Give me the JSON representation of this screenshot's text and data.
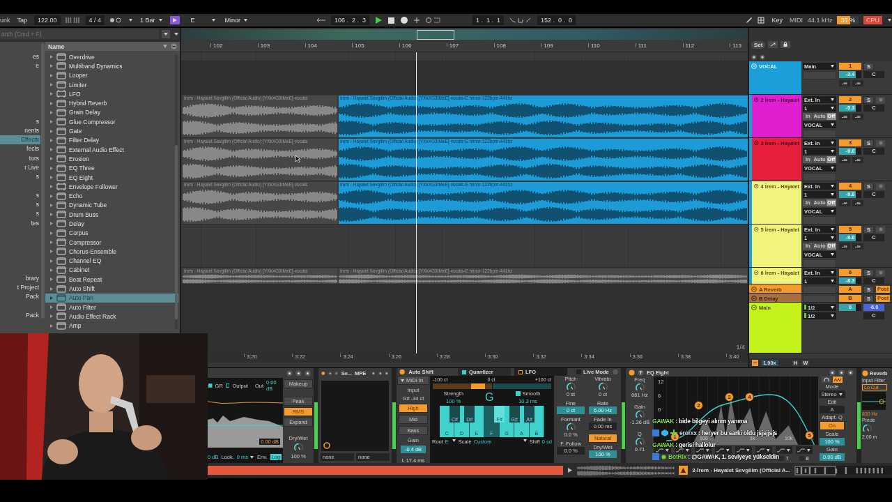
{
  "transport": {
    "playing": true,
    "left": [
      {
        "kind": "text",
        "label": "unk"
      },
      {
        "kind": "button",
        "label": "Tap"
      },
      {
        "kind": "field",
        "label": "122.00"
      },
      {
        "kind": "field",
        "label": "4 / 4"
      },
      {
        "kind": "dropdown",
        "label": "1 Bar"
      },
      {
        "kind": "key",
        "label": "E"
      },
      {
        "kind": "dropdown",
        "label": "Minor"
      }
    ],
    "center": [
      {
        "kind": "field",
        "label": "106 .  2 .  3"
      },
      {
        "kind": "field",
        "label": "1 .  1 .  1"
      },
      {
        "kind": "field",
        "label": "152 .  0 .  0"
      }
    ],
    "right": [
      {
        "kind": "button",
        "label": "Key"
      },
      {
        "kind": "text",
        "label": "MIDI"
      },
      {
        "kind": "text",
        "label": "44.1 kHz"
      },
      {
        "kind": "meter",
        "label": "36 %"
      },
      {
        "kind": "alert",
        "label": "CPU"
      }
    ]
  },
  "browser": {
    "search_placeholder": "arch (Cmd + F)",
    "header": "Name",
    "category_groups": [
      [
        {
          "label": "es",
          "selected": false
        },
        {
          "label": "e",
          "selected": false
        }
      ],
      [
        {
          "label": "s",
          "selected": false
        },
        {
          "label": "nents",
          "selected": false
        },
        {
          "label": "Effects",
          "selected": true
        },
        {
          "label": "fects",
          "selected": false
        },
        {
          "label": "tors",
          "selected": false
        },
        {
          "label": "r Live",
          "selected": false
        },
        {
          "label": "s",
          "selected": false
        }
      ],
      [
        {
          "label": "s",
          "selected": false
        },
        {
          "label": "s",
          "selected": false
        },
        {
          "label": "s",
          "selected": false
        },
        {
          "label": "tes",
          "selected": false
        }
      ],
      [
        {
          "label": "brary",
          "selected": false
        },
        {
          "label": "t Project",
          "selected": false
        },
        {
          "label": "Pack",
          "selected": false
        }
      ],
      [
        {
          "label": "Pack",
          "selected": false
        }
      ]
    ],
    "items": [
      {
        "label": "Overdrive",
        "kind": "device",
        "selected": false
      },
      {
        "label": "Multiband Dynamics",
        "kind": "device",
        "selected": false
      },
      {
        "label": "Looper",
        "kind": "device",
        "selected": false
      },
      {
        "label": "Limiter",
        "kind": "device",
        "selected": false
      },
      {
        "label": "LFO",
        "kind": "max",
        "selected": false
      },
      {
        "label": "Hybrid Reverb",
        "kind": "device",
        "selected": false
      },
      {
        "label": "Grain Delay",
        "kind": "device",
        "selected": false
      },
      {
        "label": "Glue Compressor",
        "kind": "device",
        "selected": false
      },
      {
        "label": "Gate",
        "kind": "device",
        "selected": false
      },
      {
        "label": "Filter Delay",
        "kind": "device",
        "selected": false
      },
      {
        "label": "External Audio Effect",
        "kind": "device",
        "selected": false
      },
      {
        "label": "Erosion",
        "kind": "device",
        "selected": false
      },
      {
        "label": "EQ Three",
        "kind": "device",
        "selected": false
      },
      {
        "label": "EQ Eight",
        "kind": "device",
        "selected": false
      },
      {
        "label": "Envelope Follower",
        "kind": "max",
        "selected": false
      },
      {
        "label": "Echo",
        "kind": "device",
        "selected": false
      },
      {
        "label": "Dynamic Tube",
        "kind": "device",
        "selected": false
      },
      {
        "label": "Drum Buss",
        "kind": "device",
        "selected": false
      },
      {
        "label": "Delay",
        "kind": "device",
        "selected": false
      },
      {
        "label": "Corpus",
        "kind": "device",
        "selected": false
      },
      {
        "label": "Compressor",
        "kind": "device",
        "selected": false
      },
      {
        "label": "Chorus-Ensemble",
        "kind": "device",
        "selected": false
      },
      {
        "label": "Channel EQ",
        "kind": "device",
        "selected": false
      },
      {
        "label": "Cabinet",
        "kind": "device",
        "selected": false
      },
      {
        "label": "Beat Repeat",
        "kind": "device",
        "selected": false
      },
      {
        "label": "Auto Shift",
        "kind": "device",
        "selected": false
      },
      {
        "label": "Auto Pan",
        "kind": "device",
        "selected": true
      },
      {
        "label": "Auto Filter",
        "kind": "device",
        "selected": false
      },
      {
        "label": "Audio Effect Rack",
        "kind": "device",
        "selected": false
      },
      {
        "label": "Amp",
        "kind": "device",
        "selected": false
      }
    ]
  },
  "arrangement": {
    "bars": [
      "102",
      "103",
      "104",
      "105",
      "106",
      "107",
      "108",
      "109",
      "110",
      "111",
      "112",
      "113"
    ],
    "times": [
      "3:20",
      "3:22",
      "3:24",
      "3:26",
      "3:28",
      "3:30",
      "3:32",
      "3:34",
      "3:36",
      "3:38",
      "3:40"
    ],
    "zoom": "1/4"
  },
  "mixer": {
    "set": "Set",
    "speed": "1.00x",
    "buttons": [
      "H",
      "W"
    ]
  },
  "tracks": [
    {
      "name": "VOCAL",
      "kind": "group",
      "grouped": false,
      "color": "#1b9fd8",
      "input": "Main",
      "number": "1",
      "solo": "S",
      "volume": "-3.4",
      "pan": "C",
      "peaks": [
        "-∞",
        "-∞"
      ]
    },
    {
      "name": "2 İrem - Hayalet",
      "kind": "audio",
      "grouped": true,
      "color": "#e01fd0",
      "input": "Ext. In",
      "channel": "1",
      "monitor": [
        {
          "label": "In",
          "selected": false
        },
        {
          "label": "Auto",
          "selected": false
        },
        {
          "label": "Off",
          "selected": true
        }
      ],
      "output": "VOCAL",
      "number": "2",
      "solo": "S",
      "volume": "-5.3",
      "pan": "C",
      "peaks": [
        "-∞",
        "-∞"
      ],
      "clips": [
        {
          "label": "İrem - Hayalet Sevgilim (Official Audio) [YXkXG3tMeE]-vocals",
          "kind": "inactive"
        },
        {
          "label": "İrem - Hayalet Sevgilim (Official Audio) [YXkXG3tMeE]-vocals-E minor-122bpm-441hz",
          "kind": "active"
        }
      ]
    },
    {
      "name": "3 İrem - Hayalet",
      "kind": "audio",
      "grouped": true,
      "color": "#e6203a",
      "input": "Ext. In",
      "channel": "1",
      "monitor": [
        {
          "label": "In",
          "selected": false
        },
        {
          "label": "Auto",
          "selected": false
        },
        {
          "label": "Off",
          "selected": true
        }
      ],
      "output": "VOCAL",
      "number": "3",
      "solo": "S",
      "volume": "-9.8",
      "pan": "C",
      "peaks": [
        "-∞",
        "-∞"
      ],
      "clips": [
        {
          "label": "İrem - Hayalet Sevgilim (Official Audio) [YXkXG3tMeE]-vocals",
          "kind": "inactive"
        },
        {
          "label": "İrem - Hayalet Sevgilim (Official Audio) [YXkXG3tMeE]-vocals-E minor-122bpm-441hz",
          "kind": "active"
        }
      ]
    },
    {
      "name": "4 İrem - Hayalet",
      "kind": "audio",
      "grouped": true,
      "color": "#f1f47c",
      "input": "Ext. In",
      "channel": "1",
      "monitor": [
        {
          "label": "In",
          "selected": false
        },
        {
          "label": "Auto",
          "selected": false
        },
        {
          "label": "Off",
          "selected": true
        }
      ],
      "output": "VOCAL",
      "number": "4",
      "solo": "S",
      "volume": "-9.8",
      "pan": "C",
      "peaks": [
        "-∞",
        "-∞"
      ],
      "clips": [
        {
          "label": "İrem - Hayalet Sevgilim (Official Audio) [YXkXG3tMeE]-vocals",
          "kind": "inactive"
        },
        {
          "label": "İrem - Hayalet Sevgilim (Official Audio) [YXkXG3tMeE]-vocals-E minor-122bpm-441hz",
          "kind": "active"
        }
      ]
    },
    {
      "name": "5 İrem - Hayalet",
      "kind": "audio",
      "grouped": true,
      "color": "#f1f47c",
      "input": "Ext. In",
      "channel": "1",
      "monitor": [
        {
          "label": "In",
          "selected": false
        },
        {
          "label": "Auto",
          "selected": false
        },
        {
          "label": "Off",
          "selected": true
        }
      ],
      "output": "VOCAL",
      "number": "5",
      "solo": "S",
      "volume": "-9.8",
      "pan": "C",
      "peaks": [
        "-∞",
        "-∞"
      ]
    },
    {
      "name": "6 İrem - Hayalet",
      "kind": "audio",
      "grouped": true,
      "color": "#f1f47c",
      "input": "Ext. In",
      "channel": "1",
      "number": "6",
      "solo": "S",
      "volume": "-8.3",
      "pan": "C",
      "clips": [
        {
          "label": "İrem - Hayalet Sevgilim (Official Audio) [YXkXG3tMeE]-vocals",
          "kind": "inactive"
        },
        {
          "label": "İrem - Hayalet Sevgilim (Official Audio) [YXkXG3tMeE]-vocals-E minor-122bpm-441hz",
          "kind": "inactive"
        }
      ]
    },
    {
      "name": "A Reverb",
      "kind": "return",
      "grouped": false,
      "color": "#f39b2d",
      "number": "A",
      "solo": "S",
      "send": "Post"
    },
    {
      "name": "B Delay",
      "kind": "return",
      "grouped": false,
      "color": "#a8703f",
      "number": "B",
      "solo": "S",
      "send": "Post"
    },
    {
      "name": "Main",
      "kind": "main",
      "grouped": false,
      "color": "#c4f21c",
      "outputs": [
        "1/2",
        "1/2"
      ],
      "number": "0",
      "volume": "-6.0",
      "pan": "C"
    }
  ],
  "devices": [
    {
      "kind": "compressor",
      "legend": [
        "GR",
        "Output"
      ],
      "out_label": "Out",
      "out_value": "0.00 dB",
      "graph_value": "0.00 dB",
      "makeup": "Makeup",
      "modes": [
        {
          "label": "Peak",
          "selected": false
        },
        {
          "label": "RMS",
          "selected": true
        },
        {
          "label": "Expand",
          "selected": false
        }
      ],
      "drywet_label": "Dry/Wet",
      "drywet": "100 %",
      "threshold": "0 dB",
      "lookahead": {
        "label": "Look.",
        "value": "0 ms"
      },
      "envelope": {
        "label": "Env.",
        "value": "Log"
      }
    },
    {
      "kind": "blank",
      "on": true,
      "title": "Se...",
      "badge": "MPE",
      "slots": [
        "none",
        "none"
      ]
    },
    {
      "kind": "autoshift",
      "on": true,
      "title": "Auto Shift",
      "midi": "MIDI In",
      "input_label": "Input",
      "detected": "G# -34 ct",
      "ranges": [
        {
          "label": "High",
          "selected": true
        },
        {
          "label": "Mid",
          "selected": false
        },
        {
          "label": "Bass",
          "selected": false
        }
      ],
      "gain_label": "Gain",
      "gain": "-0.4 dB",
      "latency": "L 17.4 ms",
      "tabs": [
        {
          "label": "Quantizer",
          "selected": true
        },
        {
          "label": "LFO",
          "selected": false
        }
      ],
      "scale_marks": [
        "-100 ct",
        "0 ct",
        "+100 ct"
      ],
      "strength_label": "Strength",
      "strength": "100 %",
      "note": "G",
      "smooth": {
        "label": "Smooth",
        "checked": true,
        "value": "10.3 ms"
      },
      "keys": [
        {
          "label": "C",
          "kind": "white",
          "on": true
        },
        {
          "label": "C#",
          "kind": "black",
          "on": false
        },
        {
          "label": "D",
          "kind": "white",
          "on": true
        },
        {
          "label": "D#",
          "kind": "black",
          "on": false
        },
        {
          "label": "E",
          "kind": "white",
          "on": true
        },
        {
          "label": "F",
          "kind": "white",
          "on": false
        },
        {
          "label": "F#",
          "kind": "black",
          "on": true
        },
        {
          "label": "G",
          "kind": "white",
          "on": true
        },
        {
          "label": "G#",
          "kind": "black",
          "on": false
        },
        {
          "label": "A",
          "kind": "white",
          "on": true
        },
        {
          "label": "A#",
          "kind": "black",
          "on": false
        },
        {
          "label": "B",
          "kind": "white",
          "on": true
        }
      ],
      "root_label": "Root",
      "root": "E",
      "scale_label": "Scale",
      "scale": "Custom",
      "shift_label": "Shift",
      "shift": "0 sd",
      "live": {
        "label": "Live Mode",
        "checked": false
      },
      "columns": [
        [
          {
            "label": "Pitch",
            "value": "0 st",
            "kind": "knob"
          },
          {
            "label": "Fine",
            "value": "0 ct",
            "kind": "accent"
          },
          {
            "label": "Formant",
            "value": "0.0 %",
            "kind": "knob"
          },
          {
            "label": "F. Follow",
            "value": "0.0 %",
            "kind": "field"
          }
        ],
        [
          {
            "label": "Vibrato",
            "value": "0 ct",
            "kind": "knob"
          },
          {
            "label": "Rate",
            "value": "6.00 Hz",
            "kind": "accent"
          },
          {
            "label": "Fade In",
            "value": "0.00 ms",
            "kind": "field"
          },
          {
            "label": "Natural",
            "kind": "button"
          },
          {
            "label": "Dry/Wet",
            "value": "100 %",
            "kind": "accent"
          }
        ]
      ]
    },
    {
      "kind": "eq",
      "on": true,
      "title": "EQ Eight",
      "params": [
        {
          "label": "Freq",
          "value": "861 Hz"
        },
        {
          "label": "Gain",
          "value": "-1.36 dB"
        },
        {
          "label": "Q",
          "value": "0.71"
        }
      ],
      "db_labels": [
        "12",
        "6",
        "0"
      ],
      "freq_labels": [
        "100",
        "1k",
        "10k"
      ],
      "bands": [
        "1",
        "2",
        "3",
        "4",
        "5"
      ],
      "band_toggles": [
        "7",
        "8"
      ],
      "side": [
        {
          "label": "Mode",
          "value": "Stereo",
          "kind": "dropdown"
        },
        {
          "label": "Edit",
          "value": "A",
          "kind": "field"
        },
        {
          "label": "Adapt. Q",
          "value": "On",
          "kind": "toggle"
        },
        {
          "label": "Scale",
          "value": "100 %",
          "kind": "accent"
        },
        {
          "label": "Gain",
          "value": "0.00 dB",
          "kind": "accent"
        }
      ]
    },
    {
      "kind": "reverb",
      "on": true,
      "title": "Reverb",
      "section": "Input Filter",
      "button": "Lo Cut",
      "freq": "830 Hz",
      "param": "Prede",
      "value": "2.00 m"
    }
  ],
  "chat": [
    {
      "user": "GAWAK",
      "text": ": bide bilgeyi alırım yanıma",
      "kind": "viewer",
      "color": "#86e04a"
    },
    {
      "user": "erorxx",
      "text": ": heryer bu sarki oldu jsjsjjsjs",
      "kind": "badged",
      "color": "#c9d6ff"
    },
    {
      "user": "GAWAK",
      "text": ": gerisi hallolur",
      "kind": "viewer",
      "color": "#86e04a"
    },
    {
      "user": "BotRix",
      "text": ": @GAWAK, 1. seviyeye yükseldin",
      "kind": "bot",
      "color": "#86e04a"
    }
  ],
  "status": {
    "clip": "3-İrem - Hayalet Sevgilim (Official A..."
  }
}
